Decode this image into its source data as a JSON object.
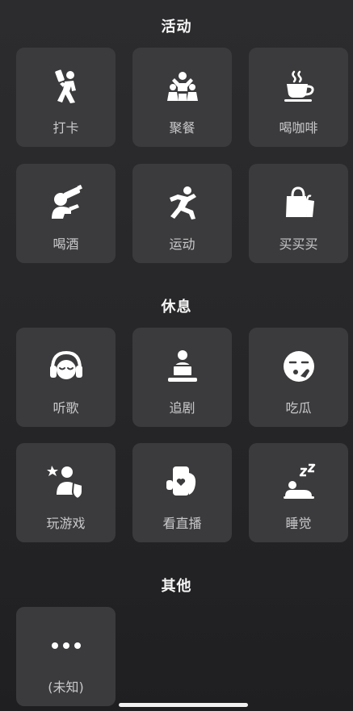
{
  "sections": [
    {
      "title": "活动",
      "items": [
        {
          "label": "打卡",
          "icon": "check-in-figure-icon"
        },
        {
          "label": "聚餐",
          "icon": "group-dinner-icon"
        },
        {
          "label": "喝咖啡",
          "icon": "coffee-cup-icon"
        },
        {
          "label": "喝酒",
          "icon": "drinking-icon"
        },
        {
          "label": "运动",
          "icon": "running-figure-icon"
        },
        {
          "label": "买买买",
          "icon": "shopping-bag-icon"
        }
      ]
    },
    {
      "title": "休息",
      "items": [
        {
          "label": "听歌",
          "icon": "headphones-face-icon"
        },
        {
          "label": "追剧",
          "icon": "watching-tv-icon"
        },
        {
          "label": "吃瓜",
          "icon": "gossip-face-icon"
        },
        {
          "label": "玩游戏",
          "icon": "game-shield-icon"
        },
        {
          "label": "看直播",
          "icon": "live-stream-phone-icon"
        },
        {
          "label": "睡觉",
          "icon": "sleeping-zzz-icon"
        }
      ]
    },
    {
      "title": "其他",
      "items": [
        {
          "label": "(未知)",
          "icon": "more-dots-icon"
        }
      ]
    }
  ],
  "colors": {
    "background": "#2a2a2c",
    "tile": "#3b3b3d",
    "label": "#c9c9cb",
    "icon": "#ffffff"
  }
}
